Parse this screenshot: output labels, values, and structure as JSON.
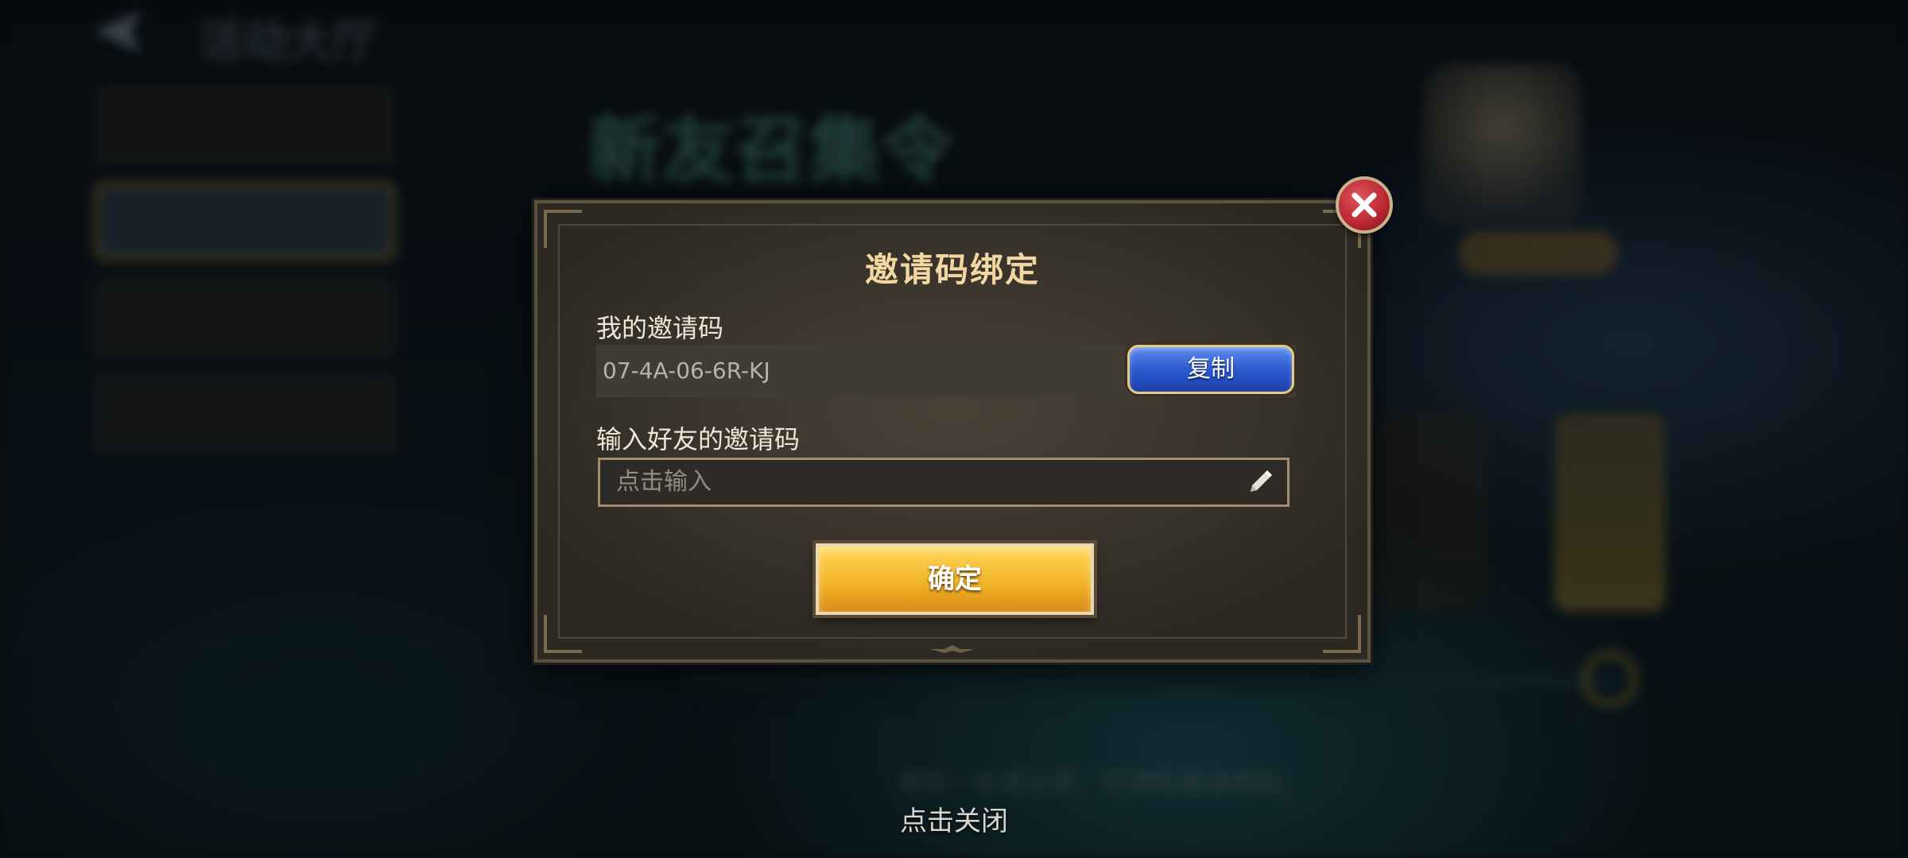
{
  "background": {
    "header_title": "活动大厅",
    "event_heading": "新友召集令",
    "footer_note": "绑定一名老玩家，可领取邀请奖励。",
    "accent_gold": "#c99a3a",
    "accent_teal": "#5aa69a"
  },
  "dialog": {
    "title": "邀请码绑定",
    "my_code_label": "我的邀请码",
    "my_code_value": "07-4A-06-6R-KJ",
    "copy_label": "复制",
    "friend_code_label": "输入好友的邀请码",
    "friend_code_placeholder": "点击输入",
    "confirm_label": "确定",
    "close_icon": "close-icon",
    "edit_icon": "pencil-icon"
  },
  "tap_to_close": "点击关闭",
  "colors": {
    "title_gold": "#f3d7a2",
    "copy_blue": "#2d5ad0",
    "confirm_gold": "#f3b52a",
    "close_red": "#b82631"
  }
}
